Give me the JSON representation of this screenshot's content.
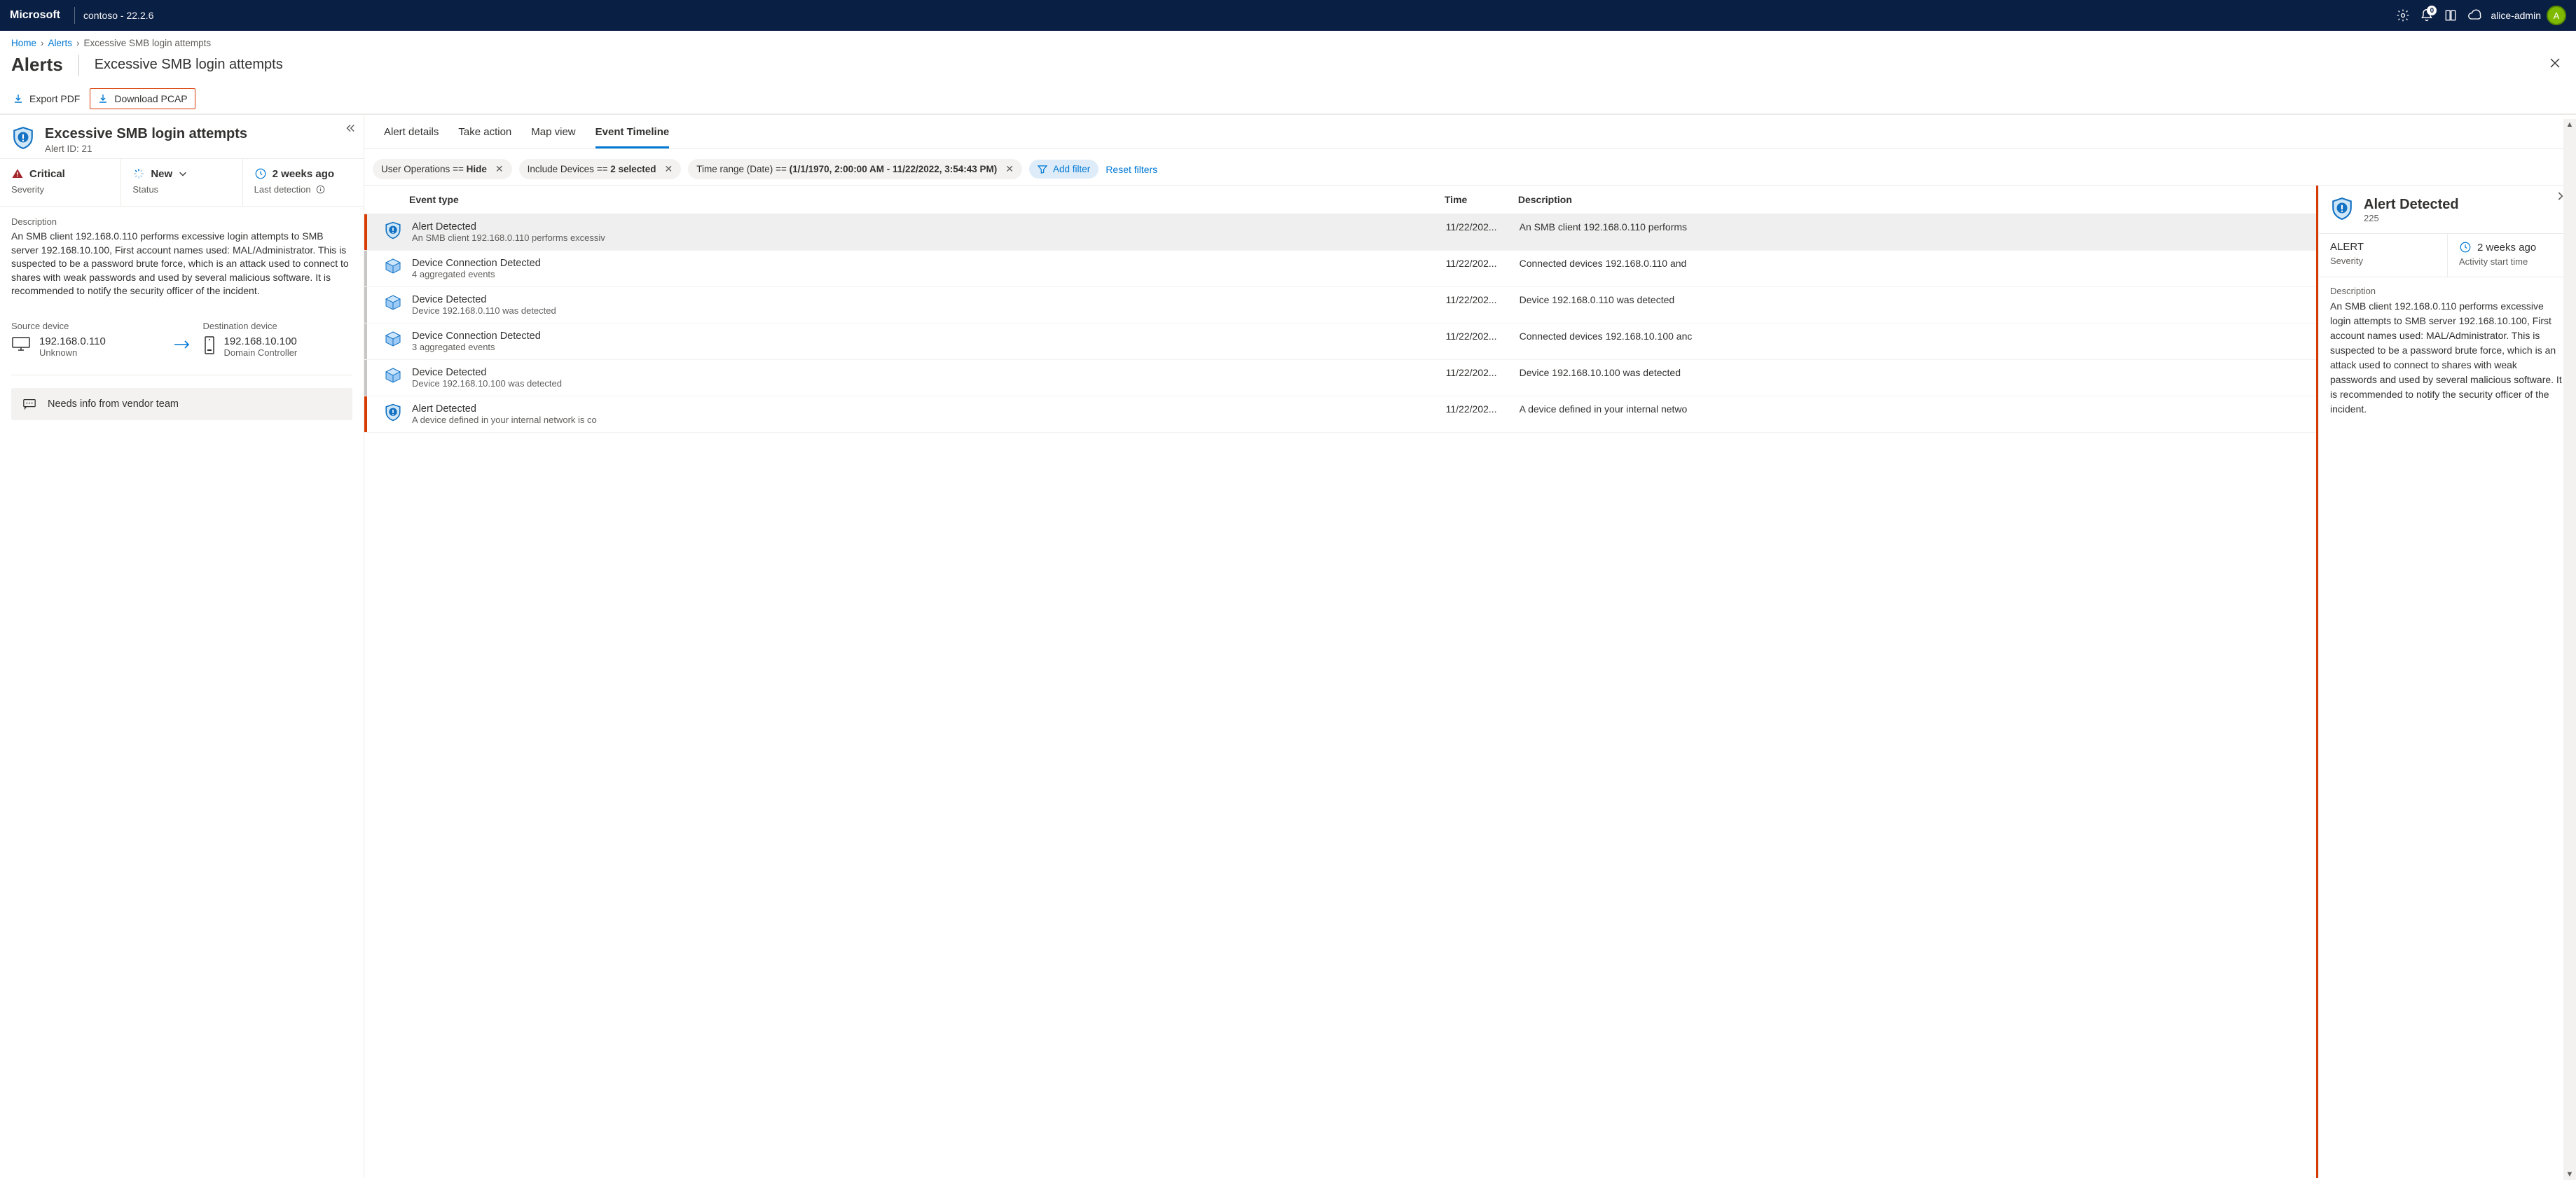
{
  "header": {
    "brand": "Microsoft",
    "tenant": "contoso - 22.2.6",
    "notificationCount": "0",
    "user": "alice-admin",
    "avatarLetter": "A"
  },
  "breadcrumb": {
    "home": "Home",
    "alerts": "Alerts",
    "current": "Excessive SMB login attempts"
  },
  "page": {
    "h1": "Alerts",
    "subtitle": "Excessive SMB login attempts"
  },
  "commands": {
    "export": "Export PDF",
    "pcap": "Download PCAP"
  },
  "alert": {
    "title": "Excessive SMB login attempts",
    "idLabel": "Alert ID: 21",
    "severity": {
      "value": "Critical",
      "label": "Severity"
    },
    "status": {
      "value": "New",
      "label": "Status"
    },
    "lastDetection": {
      "value": "2 weeks ago",
      "label": "Last detection"
    },
    "descriptionLabel": "Description",
    "description": "An SMB client 192.168.0.110 performs excessive login attempts to SMB server 192.168.10.100, First account names used: MAL/Administrator. This is suspected to be a password brute force, which is an attack used to connect to shares with weak passwords and used by several malicious software. It is recommended to notify the security officer of the incident.",
    "source": {
      "label": "Source device",
      "ip": "192.168.0.110",
      "sub": "Unknown"
    },
    "dest": {
      "label": "Destination device",
      "ip": "192.168.10.100",
      "sub": "Domain Controller"
    },
    "note": "Needs info from vendor team"
  },
  "tabs": [
    "Alert details",
    "Take action",
    "Map view",
    "Event Timeline"
  ],
  "activeTab": "Event Timeline",
  "filters": {
    "userOps": {
      "key": "User Operations",
      "op": "==",
      "value": "Hide"
    },
    "devices": {
      "key": "Include Devices",
      "op": "==",
      "value": "2 selected"
    },
    "time": {
      "key": "Time range (Date)",
      "op": "==",
      "value": "(1/1/1970, 2:00:00 AM - 11/22/2022, 3:54:43 PM)"
    },
    "addFilter": "Add filter",
    "reset": "Reset filters"
  },
  "table": {
    "head": {
      "type": "Event type",
      "time": "Time",
      "desc": "Description"
    },
    "rows": [
      {
        "kind": "alert",
        "title": "Alert Detected",
        "sub": "An SMB client 192.168.0.110 performs excessiv",
        "time": "11/22/202...",
        "desc": "An SMB client 192.168.0.110 performs",
        "sel": true
      },
      {
        "kind": "dev",
        "title": "Device Connection Detected",
        "sub": "4 aggregated events",
        "time": "11/22/202...",
        "desc": "Connected devices 192.168.0.110 and "
      },
      {
        "kind": "dev",
        "title": "Device Detected",
        "sub": "Device 192.168.0.110 was detected",
        "time": "11/22/202...",
        "desc": "Device 192.168.0.110 was detected"
      },
      {
        "kind": "dev",
        "title": "Device Connection Detected",
        "sub": "3 aggregated events",
        "time": "11/22/202...",
        "desc": "Connected devices 192.168.10.100 anc"
      },
      {
        "kind": "dev",
        "title": "Device Detected",
        "sub": "Device 192.168.10.100 was detected",
        "time": "11/22/202...",
        "desc": "Device 192.168.10.100 was detected"
      },
      {
        "kind": "alert",
        "title": "Alert Detected",
        "sub": "A device defined in your internal network is co",
        "time": "11/22/202...",
        "desc": "A device defined in your internal netwo"
      }
    ]
  },
  "side": {
    "title": "Alert Detected",
    "count": "225",
    "sev": {
      "value": "ALERT",
      "label": "Severity"
    },
    "start": {
      "value": "2 weeks ago",
      "label": "Activity start time"
    },
    "descriptionLabel": "Description",
    "description": "An SMB client 192.168.0.110 performs excessive login attempts to SMB server 192.168.10.100, First account names used: MAL/Administrator. This is suspected to be a password brute force, which is an attack used to connect to shares with weak passwords and used by several malicious software. It is recommended to notify the security officer of the incident."
  }
}
